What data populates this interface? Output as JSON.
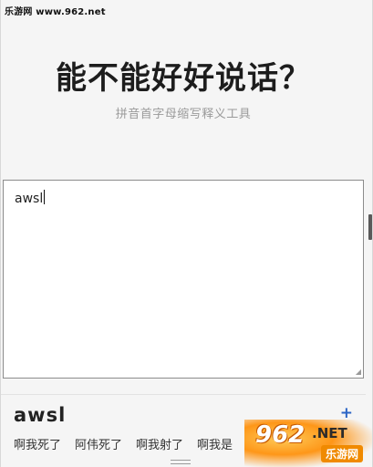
{
  "watermark": "乐游网 www.962.net",
  "header": {
    "title": "能不能好好说话？",
    "subtitle": "拼音首字母缩写释义工具"
  },
  "editor": {
    "value": "awsl"
  },
  "result": {
    "term": "awsl",
    "add_label": "+",
    "meanings": [
      "啊我死了",
      "阿伟死了",
      "啊我射了",
      "啊我是"
    ]
  },
  "logo": {
    "number": "962",
    "suffix": ".NET",
    "name": "乐游网"
  },
  "colors": {
    "background": "#f5f5f5",
    "accent": "#2b64c5",
    "logo_orange": "#f08a00"
  }
}
